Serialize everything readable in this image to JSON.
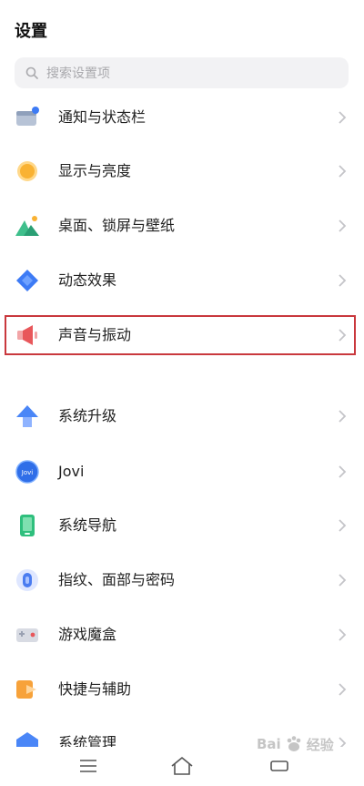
{
  "header": {
    "title": "设置"
  },
  "search": {
    "placeholder": "搜索设置项"
  },
  "settings": [
    {
      "label": "通知与状态栏",
      "icon": "notification-icon"
    },
    {
      "label": "显示与亮度",
      "icon": "brightness-icon"
    },
    {
      "label": "桌面、锁屏与壁纸",
      "icon": "wallpaper-icon"
    },
    {
      "label": "动态效果",
      "icon": "motion-effects-icon"
    },
    {
      "label": "声音与振动",
      "icon": "sound-icon",
      "highlighted": true
    },
    {
      "label": "系统升级",
      "icon": "system-update-icon"
    },
    {
      "label": "Jovi",
      "icon": "jovi-icon",
      "icon_text": "Jovi"
    },
    {
      "label": "系统导航",
      "icon": "navigation-icon"
    },
    {
      "label": "指纹、面部与密码",
      "icon": "fingerprint-icon"
    },
    {
      "label": "游戏魔盒",
      "icon": "game-box-icon"
    },
    {
      "label": "快捷与辅助",
      "icon": "shortcut-icon"
    },
    {
      "label": "系统管理",
      "icon": "system-management-icon"
    }
  ],
  "colors": {
    "highlight_border": "#c9383d",
    "sound_icon": "#e8575b",
    "accent_blue": "#3d7bf5"
  },
  "watermark": {
    "text_left": "Bai",
    "text_right": "经验"
  },
  "navbar": {
    "menu_icon": "menu-icon",
    "home_icon": "home-icon",
    "back_icon": "back-icon"
  }
}
